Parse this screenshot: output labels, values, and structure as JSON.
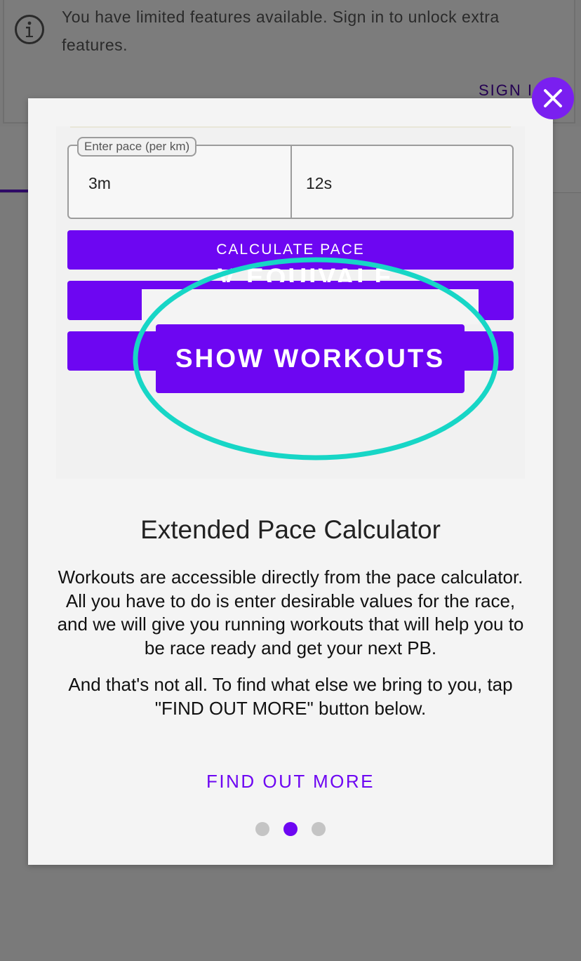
{
  "background": {
    "banner_text": "You have limited features available. Sign in to unlock extra features.",
    "sign_in_label": "SIGN I"
  },
  "modal": {
    "illustration": {
      "pace_label": "Enter pace (per km)",
      "minutes_value": "3m",
      "seconds_value": "12s",
      "calculate_label": "CALCULATE PACE",
      "equivalents_fragment": "V EQUIVALE",
      "workouts_label": "SHOW WORKOUTS"
    },
    "title": "Extended Pace Calculator",
    "paragraph1": "Workouts are accessible directly from the pace calculator. All you have to do is enter desirable values for the race, and we will give you running workouts that will help you to be race ready and get your next PB.",
    "paragraph2": "And that's not all. To find what else we bring to you, tap \"FIND OUT MORE\" button below.",
    "find_out_more_label": "FIND OUT MORE",
    "pager": {
      "total": 3,
      "active_index": 1
    }
  },
  "colors": {
    "accent": "#6d06f2",
    "close_button": "#7a1ff0",
    "highlight_ellipse": "#17d6c6",
    "overlay": "#7a7a7a"
  },
  "icons": {
    "banner": "info-icon",
    "close": "close-icon"
  }
}
